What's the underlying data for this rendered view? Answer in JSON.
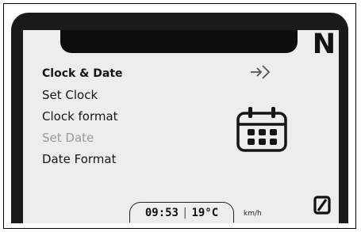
{
  "header": {
    "gear": "N"
  },
  "menu": {
    "title": "Clock & Date",
    "items": [
      {
        "label": "Set Clock"
      },
      {
        "label": "Clock format"
      },
      {
        "label": "Set Date",
        "selected": true
      },
      {
        "label": "Date Format"
      }
    ]
  },
  "icons": {
    "enter": "enter-arrow-icon",
    "calendar": "calendar-icon",
    "reset": "reset-icon"
  },
  "status": {
    "time": "09:53",
    "separator": "|",
    "temperature": "19°C",
    "speed_unit": "km/h"
  },
  "colors": {
    "screen_bg": "#ededed",
    "bezel": "#1a1a1a",
    "text": "#161616",
    "selected_text": "#9a9a9a"
  }
}
